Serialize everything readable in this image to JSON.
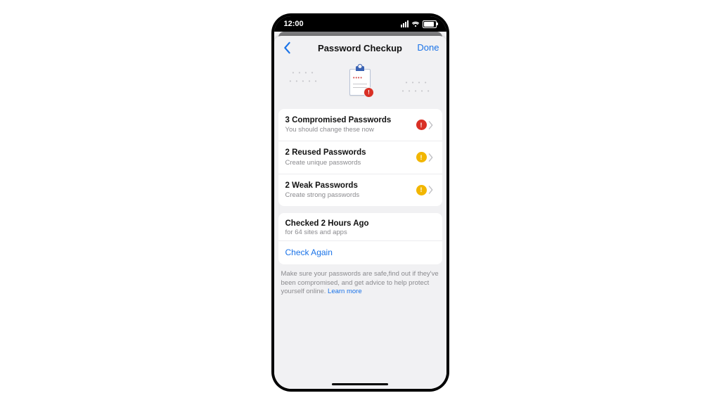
{
  "statusbar": {
    "time": "12:00"
  },
  "nav": {
    "title": "Password Checkup",
    "done": "Done"
  },
  "items": [
    {
      "title": "3 Compromised Passwords",
      "subtitle": "You should change these now",
      "severity": "red"
    },
    {
      "title": "2 Reused Passwords",
      "subtitle": "Create unique passwords",
      "severity": "amber"
    },
    {
      "title": "2 Weak Passwords",
      "subtitle": "Create strong passwords",
      "severity": "amber"
    }
  ],
  "status": {
    "title": "Checked 2 Hours Ago",
    "subtitle": "for 64 sites and apps",
    "action": "Check Again"
  },
  "footer": {
    "text": "Make sure your passwords are safe,find out if they've been compromised, and get advice to help protect yourself online. ",
    "link": "Learn more"
  },
  "colors": {
    "accent": "#1a73e8",
    "danger": "#d93025",
    "warning": "#f2b600"
  }
}
